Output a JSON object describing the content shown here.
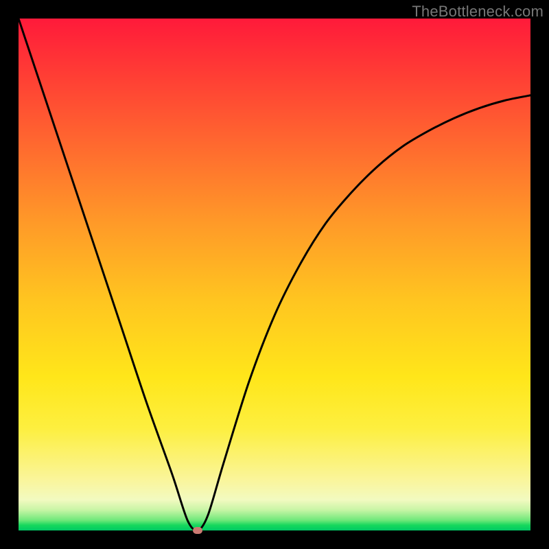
{
  "watermark": "TheBottleneck.com",
  "chart_data": {
    "type": "line",
    "title": "",
    "xlabel": "",
    "ylabel": "",
    "xlim": [
      0,
      100
    ],
    "ylim": [
      0,
      100
    ],
    "grid": false,
    "legend": false,
    "series": [
      {
        "name": "bottleneck-curve",
        "x": [
          0,
          5,
          10,
          15,
          20,
          25,
          30,
          33,
          35,
          37,
          40,
          45,
          50,
          55,
          60,
          65,
          70,
          75,
          80,
          85,
          90,
          95,
          100
        ],
        "y": [
          100,
          85,
          70,
          55,
          40,
          25,
          11,
          2,
          0,
          3,
          13,
          29,
          42,
          52,
          60,
          66,
          71,
          75,
          78,
          80.5,
          82.5,
          84,
          85
        ]
      }
    ],
    "optimum_point": {
      "x": 35,
      "y": 0
    }
  },
  "colors": {
    "curve": "#000000",
    "marker": "#cc7a72",
    "frame_border": "#000000"
  }
}
